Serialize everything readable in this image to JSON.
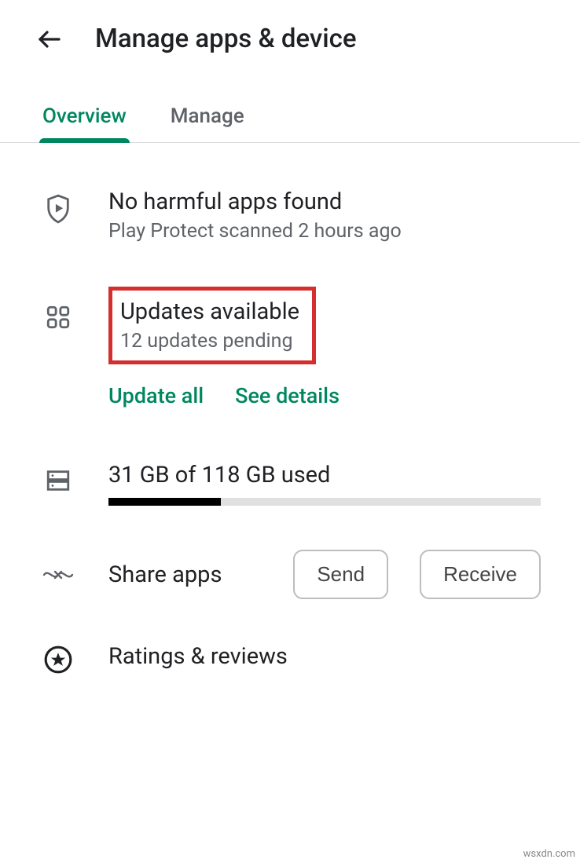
{
  "header": {
    "title": "Manage apps & device"
  },
  "tabs": {
    "overview": "Overview",
    "manage": "Manage"
  },
  "protect": {
    "title": "No harmful apps found",
    "subtitle": "Play Protect scanned 2 hours ago"
  },
  "updates": {
    "title": "Updates available",
    "subtitle": "12 updates pending",
    "update_all": "Update all",
    "see_details": "See details"
  },
  "storage": {
    "text": "31 GB of 118 GB used",
    "fill_percent": 26
  },
  "share": {
    "label": "Share apps",
    "send": "Send",
    "receive": "Receive"
  },
  "ratings": {
    "label": "Ratings & reviews"
  },
  "watermark": "wsxdn.com"
}
